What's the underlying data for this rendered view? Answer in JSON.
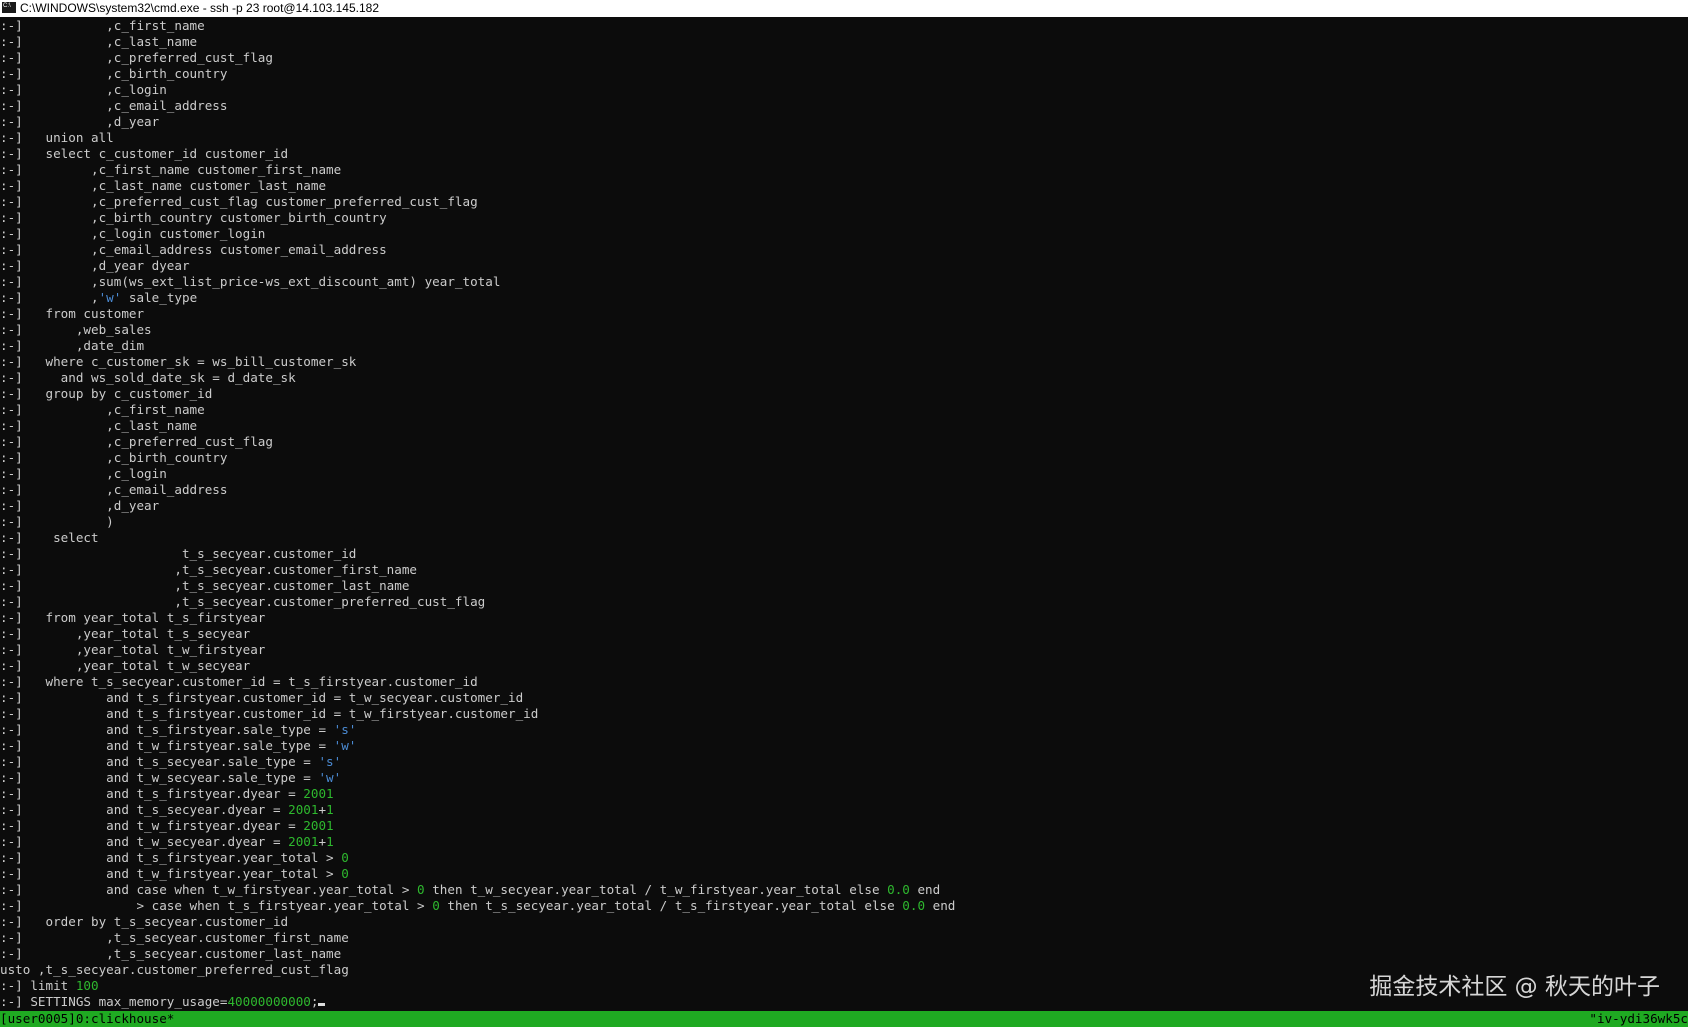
{
  "window": {
    "title": "C:\\WINDOWS\\system32\\cmd.exe - ssh  -p 23 root@14.103.145.182"
  },
  "terminal": {
    "lines": [
      [
        {
          "t": ":-]           ,c_first_name"
        }
      ],
      [
        {
          "t": ":-]           ,c_last_name"
        }
      ],
      [
        {
          "t": ":-]           ,c_preferred_cust_flag"
        }
      ],
      [
        {
          "t": ":-]           ,c_birth_country"
        }
      ],
      [
        {
          "t": ":-]           ,c_login"
        }
      ],
      [
        {
          "t": ":-]           ,c_email_address"
        }
      ],
      [
        {
          "t": ":-]           ,d_year"
        }
      ],
      [
        {
          "t": ":-]   union all"
        }
      ],
      [
        {
          "t": ":-]   select c_customer_id customer_id"
        }
      ],
      [
        {
          "t": ":-]         ,c_first_name customer_first_name"
        }
      ],
      [
        {
          "t": ":-]         ,c_last_name customer_last_name"
        }
      ],
      [
        {
          "t": ":-]         ,c_preferred_cust_flag customer_preferred_cust_flag"
        }
      ],
      [
        {
          "t": ":-]         ,c_birth_country customer_birth_country"
        }
      ],
      [
        {
          "t": ":-]         ,c_login customer_login"
        }
      ],
      [
        {
          "t": ":-]         ,c_email_address customer_email_address"
        }
      ],
      [
        {
          "t": ":-]         ,d_year dyear"
        }
      ],
      [
        {
          "t": ":-]         ,sum(ws_ext_list_price-ws_ext_discount_amt) year_total"
        }
      ],
      [
        {
          "t": ":-]         ,"
        },
        {
          "t": "'w'",
          "c": "str"
        },
        {
          "t": " sale_type"
        }
      ],
      [
        {
          "t": ":-]   from customer"
        }
      ],
      [
        {
          "t": ":-]       ,web_sales"
        }
      ],
      [
        {
          "t": ":-]       ,date_dim"
        }
      ],
      [
        {
          "t": ":-]   where c_customer_sk = ws_bill_customer_sk"
        }
      ],
      [
        {
          "t": ":-]     and ws_sold_date_sk = d_date_sk"
        }
      ],
      [
        {
          "t": ":-]   group by c_customer_id"
        }
      ],
      [
        {
          "t": ":-]           ,c_first_name"
        }
      ],
      [
        {
          "t": ":-]           ,c_last_name"
        }
      ],
      [
        {
          "t": ":-]           ,c_preferred_cust_flag"
        }
      ],
      [
        {
          "t": ":-]           ,c_birth_country"
        }
      ],
      [
        {
          "t": ":-]           ,c_login"
        }
      ],
      [
        {
          "t": ":-]           ,c_email_address"
        }
      ],
      [
        {
          "t": ":-]           ,d_year"
        }
      ],
      [
        {
          "t": ":-]           )"
        }
      ],
      [
        {
          "t": ":-]    select"
        }
      ],
      [
        {
          "t": ":-]                     t_s_secyear.customer_id"
        }
      ],
      [
        {
          "t": ":-]                    ,t_s_secyear.customer_first_name"
        }
      ],
      [
        {
          "t": ":-]                    ,t_s_secyear.customer_last_name"
        }
      ],
      [
        {
          "t": ":-]                    ,t_s_secyear.customer_preferred_cust_flag"
        }
      ],
      [
        {
          "t": ":-]   from year_total t_s_firstyear"
        }
      ],
      [
        {
          "t": ":-]       ,year_total t_s_secyear"
        }
      ],
      [
        {
          "t": ":-]       ,year_total t_w_firstyear"
        }
      ],
      [
        {
          "t": ":-]       ,year_total t_w_secyear"
        }
      ],
      [
        {
          "t": ":-]   where t_s_secyear.customer_id = t_s_firstyear.customer_id"
        }
      ],
      [
        {
          "t": ":-]           and t_s_firstyear.customer_id = t_w_secyear.customer_id"
        }
      ],
      [
        {
          "t": ":-]           and t_s_firstyear.customer_id = t_w_firstyear.customer_id"
        }
      ],
      [
        {
          "t": ":-]           and t_s_firstyear.sale_type = "
        },
        {
          "t": "'s'",
          "c": "str"
        }
      ],
      [
        {
          "t": ":-]           and t_w_firstyear.sale_type = "
        },
        {
          "t": "'w'",
          "c": "str"
        }
      ],
      [
        {
          "t": ":-]           and t_s_secyear.sale_type = "
        },
        {
          "t": "'s'",
          "c": "str"
        }
      ],
      [
        {
          "t": ":-]           and t_w_secyear.sale_type = "
        },
        {
          "t": "'w'",
          "c": "str"
        }
      ],
      [
        {
          "t": ":-]           and t_s_firstyear.dyear = "
        },
        {
          "t": "2001",
          "c": "num"
        }
      ],
      [
        {
          "t": ":-]           and t_s_secyear.dyear = "
        },
        {
          "t": "2001",
          "c": "num"
        },
        {
          "t": "+"
        },
        {
          "t": "1",
          "c": "num"
        }
      ],
      [
        {
          "t": ":-]           and t_w_firstyear.dyear = "
        },
        {
          "t": "2001",
          "c": "num"
        }
      ],
      [
        {
          "t": ":-]           and t_w_secyear.dyear = "
        },
        {
          "t": "2001",
          "c": "num"
        },
        {
          "t": "+"
        },
        {
          "t": "1",
          "c": "num"
        }
      ],
      [
        {
          "t": ":-]           and t_s_firstyear.year_total > "
        },
        {
          "t": "0",
          "c": "num"
        }
      ],
      [
        {
          "t": ":-]           and t_w_firstyear.year_total > "
        },
        {
          "t": "0",
          "c": "num"
        }
      ],
      [
        {
          "t": ":-]           and case when t_w_firstyear.year_total > "
        },
        {
          "t": "0",
          "c": "num"
        },
        {
          "t": " then t_w_secyear.year_total / t_w_firstyear.year_total else "
        },
        {
          "t": "0.0",
          "c": "num"
        },
        {
          "t": " end"
        }
      ],
      [
        {
          "t": ":-]               > case when t_s_firstyear.year_total > "
        },
        {
          "t": "0",
          "c": "num"
        },
        {
          "t": " then t_s_secyear.year_total / t_s_firstyear.year_total else "
        },
        {
          "t": "0.0",
          "c": "num"
        },
        {
          "t": " end"
        }
      ],
      [
        {
          "t": ":-]   order by t_s_secyear.customer_id"
        }
      ],
      [
        {
          "t": ":-]           ,t_s_secyear.customer_first_name"
        }
      ],
      [
        {
          "t": ":-]           ,t_s_secyear.customer_last_name"
        }
      ],
      [
        {
          "t": "usto ,t_s_secyear.customer_preferred_cust_flag"
        }
      ],
      [
        {
          "t": ":-] limit "
        },
        {
          "t": "100",
          "c": "num"
        }
      ],
      [
        {
          "t": ":-] SETTINGS max_memory_usage="
        },
        {
          "t": "40000000000",
          "c": "num"
        },
        {
          "t": ";"
        }
      ]
    ]
  },
  "statusbar": {
    "left": "[user0005]0:clickhouse*",
    "right": "\"iv-ydi36wk5c"
  },
  "watermark": "掘金技术社区 @ 秋天的叶子"
}
